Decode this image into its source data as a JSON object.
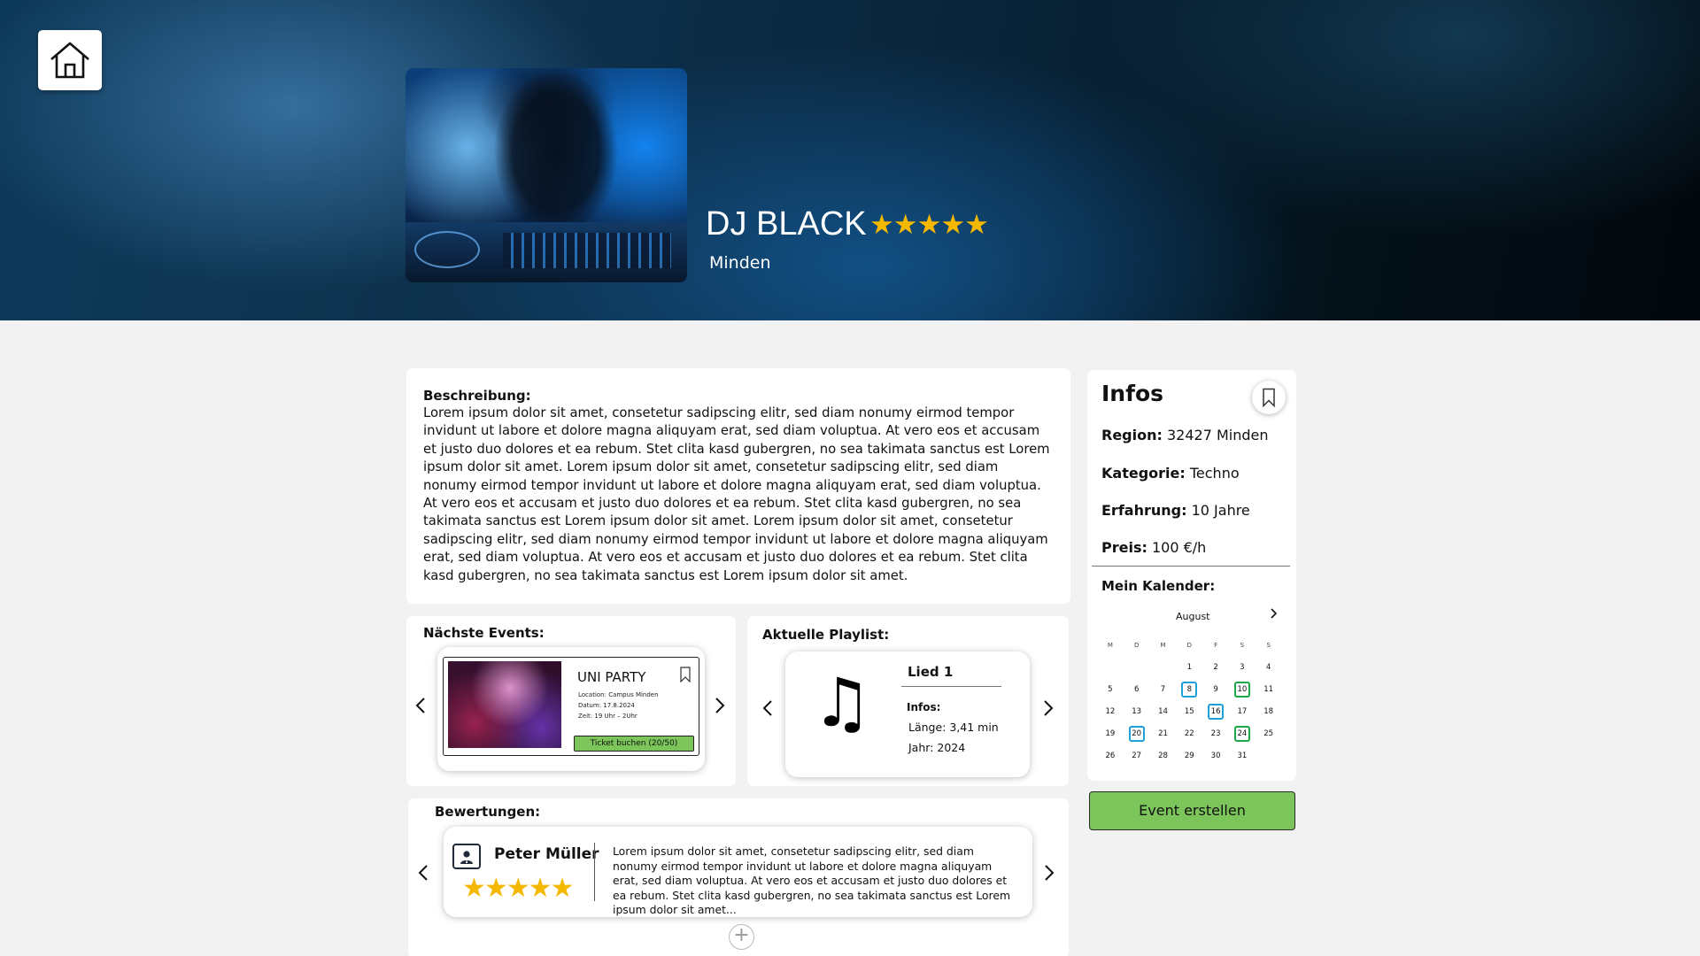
{
  "header": {
    "name": "DJ BLACK",
    "stars": "★★★★★",
    "city": "Minden"
  },
  "description": {
    "title": "Beschreibung:",
    "text": "Lorem ipsum dolor sit amet, consetetur sadipscing elitr, sed diam nonumy eirmod tempor invidunt ut labore et dolore magna aliquyam erat, sed diam voluptua. At vero eos et accusam et justo duo dolores et ea rebum. Stet clita kasd gubergren, no sea takimata sanctus est Lorem ipsum dolor sit amet. Lorem ipsum dolor sit amet, consetetur sadipscing elitr, sed diam nonumy eirmod tempor invidunt ut labore et dolore magna aliquyam erat, sed diam voluptua. At vero eos et accusam et justo duo dolores et ea rebum. Stet clita kasd gubergren, no sea takimata sanctus est Lorem ipsum dolor sit amet. Lorem ipsum dolor sit amet, consetetur sadipscing elitr, sed diam nonumy eirmod tempor invidunt ut labore et dolore magna aliquyam erat, sed diam voluptua. At vero eos et accusam et justo duo dolores et ea rebum. Stet clita kasd gubergren, no sea takimata sanctus est Lorem ipsum dolor sit amet."
  },
  "events": {
    "title": "Nächste Events:",
    "event": {
      "name": "UNI PARTY",
      "location": "Location: Campus Minden",
      "date": "Datum: 17.8.2024",
      "time": "Zeit: 19 Uhr – 2Uhr",
      "button": "Ticket buchen (20/50)"
    }
  },
  "playlist": {
    "title": "Aktuelle Playlist:",
    "note_glyph": "♫",
    "song": "Lied 1",
    "infos_label": "Infos:",
    "length": "Länge: 3,41 min",
    "year": "Jahr: 2024"
  },
  "reviews": {
    "title": "Bewertungen:",
    "review": {
      "name": "Peter Müller",
      "stars": "★★★★★",
      "text": "Lorem ipsum dolor sit amet, consetetur sadipscing elitr, sed diam nonumy eirmod tempor invidunt ut labore et dolore magna aliquyam erat, sed diam voluptua. At vero eos et accusam et justo duo dolores et ea rebum. Stet clita kasd gubergren, no sea takimata sanctus est Lorem ipsum dolor sit amet..."
    },
    "add": "+"
  },
  "infos": {
    "title": "Infos",
    "region_label": "Region:",
    "region_value": "32427 Minden",
    "category_label": "Kategorie:",
    "category_value": "Techno",
    "experience_label": "Erfahrung:",
    "experience_value": "10 Jahre",
    "price_label": "Preis:",
    "price_value": "100 €/h",
    "calendar_title": "Mein Kalender:",
    "calendar": {
      "month": "August",
      "weekdays": [
        "M",
        "D",
        "M",
        "D",
        "F",
        "S",
        "S"
      ],
      "days": [
        "",
        "",
        "",
        "1",
        "2",
        "3",
        "4",
        "5",
        "6",
        "7",
        "8",
        "9",
        "10",
        "11",
        "12",
        "13",
        "14",
        "15",
        "16",
        "17",
        "18",
        "19",
        "20",
        "21",
        "22",
        "23",
        "24",
        "25",
        "26",
        "27",
        "28",
        "29",
        "30",
        "31",
        ""
      ],
      "marked_blue": [
        "8",
        "16",
        "20"
      ],
      "marked_green": [
        "10",
        "24"
      ],
      "colors": {
        "blue": "#1ea0d8",
        "green": "#1fa84a"
      }
    }
  },
  "create_button": "Event erstellen",
  "colors": {
    "accent_green": "#7cc55a",
    "star": "#f5b800"
  },
  "icons": [
    "home-icon",
    "bookmark-icon",
    "chevron-left-icon",
    "chevron-right-icon",
    "user-icon",
    "music-note-icon",
    "plus-icon"
  ]
}
